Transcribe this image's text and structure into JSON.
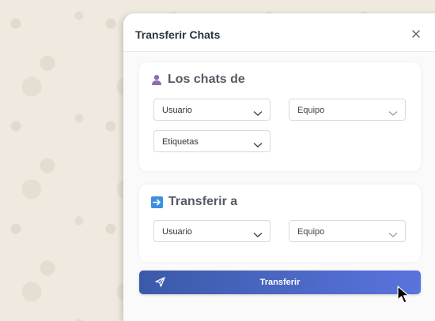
{
  "modal": {
    "title": "Transferir Chats",
    "close_icon": "close-icon"
  },
  "source_card": {
    "icon": "person-icon",
    "title": "Los chats de",
    "selects": [
      {
        "value": "Usuario"
      },
      {
        "value": "Equipo"
      },
      {
        "value": "Etiquetas"
      }
    ]
  },
  "target_card": {
    "icon": "arrow-right-icon",
    "title": "Transferir a",
    "selects": [
      {
        "value": "Usuario"
      },
      {
        "value": "Equipo"
      }
    ]
  },
  "actions": {
    "transfer_label": "Transferir",
    "transfer_icon": "send-icon"
  },
  "colors": {
    "accent_start": "#3a5aa8",
    "accent_end": "#5a73dd",
    "arrow_icon_bg": "#3b8fe0",
    "person_icon": "#8a6fb0"
  }
}
